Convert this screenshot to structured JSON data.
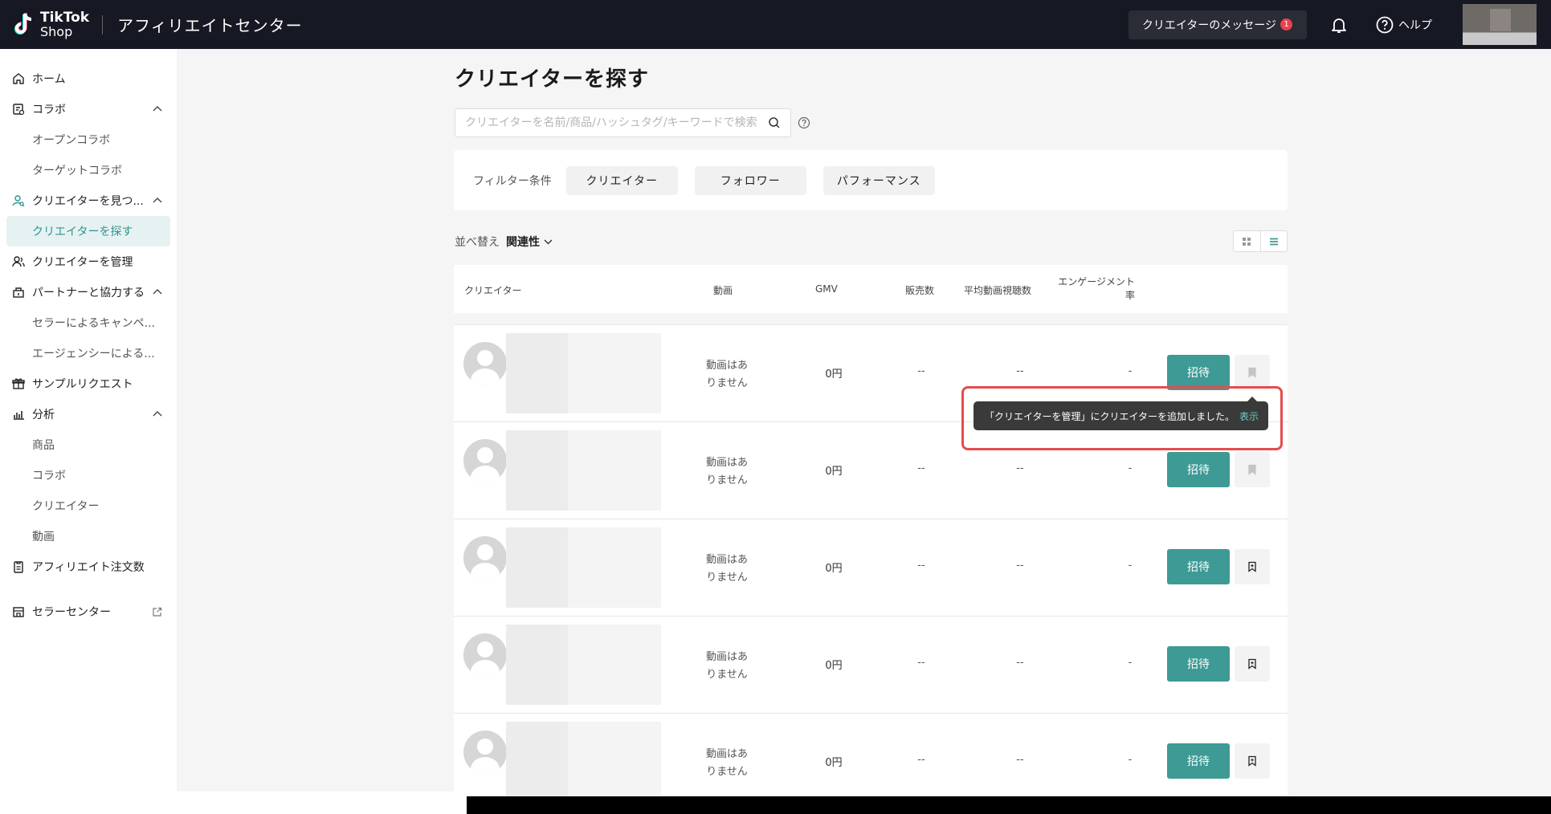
{
  "header": {
    "logo_line1": "TikTok",
    "logo_line2": "Shop",
    "title": "アフィリエイトセンター",
    "messages_label": "クリエイターのメッセージ",
    "messages_badge": "1",
    "help_label": "ヘルプ"
  },
  "sidebar": {
    "items": [
      {
        "label": "ホーム",
        "icon": "home-icon",
        "type": "top"
      },
      {
        "label": "コラボ",
        "icon": "collab-icon",
        "type": "top",
        "expanded": true
      },
      {
        "label": "オープンコラボ",
        "type": "sub"
      },
      {
        "label": "ターゲットコラボ",
        "type": "sub"
      },
      {
        "label": "クリエイターを見つ...",
        "icon": "find-creator-icon",
        "type": "top",
        "expanded": true
      },
      {
        "label": "クリエイターを探す",
        "type": "sub",
        "active": true
      },
      {
        "label": "クリエイターを管理",
        "icon": "manage-creator-icon",
        "type": "top"
      },
      {
        "label": "パートナーと協力する",
        "icon": "partner-icon",
        "type": "top",
        "expanded": true
      },
      {
        "label": "セラーによるキャンペ...",
        "type": "sub"
      },
      {
        "label": "エージェンシーによる...",
        "type": "sub"
      },
      {
        "label": "サンプルリクエスト",
        "icon": "gift-icon",
        "type": "top"
      },
      {
        "label": "分析",
        "icon": "analytics-icon",
        "type": "top",
        "expanded": true
      },
      {
        "label": "商品",
        "type": "sub"
      },
      {
        "label": "コラボ",
        "type": "sub"
      },
      {
        "label": "クリエイター",
        "type": "sub"
      },
      {
        "label": "動画",
        "type": "sub"
      },
      {
        "label": "アフィリエイト注文数",
        "icon": "orders-icon",
        "type": "top"
      },
      {
        "label": "セラーセンター",
        "icon": "store-icon",
        "type": "top",
        "external": true
      }
    ]
  },
  "main": {
    "title": "クリエイターを探す",
    "search_placeholder": "クリエイターを名前/商品/ハッシュタグ/キーワードで検索",
    "filter_label": "フィルター条件",
    "filters": [
      "クリエイター",
      "フォロワー",
      "パフォーマンス"
    ],
    "sort_label": "並べ替え",
    "sort_value": "関連性"
  },
  "table": {
    "headers": {
      "creator": "クリエイター",
      "video": "動画",
      "gmv": "GMV",
      "sales": "販売数",
      "avg_views": "平均動画視聴数",
      "engagement_1": "エンゲージメント",
      "engagement_2": "率"
    },
    "rows": [
      {
        "video_1": "動画はあ",
        "video_2": "りません",
        "gmv": "0円",
        "sales": "--",
        "avg_views": "--",
        "engagement": "-",
        "invite": "招待",
        "saved": true
      },
      {
        "video_1": "動画はあ",
        "video_2": "りません",
        "gmv": "0円",
        "sales": "--",
        "avg_views": "--",
        "engagement": "-",
        "invite": "招待",
        "saved": true
      },
      {
        "video_1": "動画はあ",
        "video_2": "りません",
        "gmv": "0円",
        "sales": "--",
        "avg_views": "--",
        "engagement": "-",
        "invite": "招待",
        "saved": false
      },
      {
        "video_1": "動画はあ",
        "video_2": "りません",
        "gmv": "0円",
        "sales": "--",
        "avg_views": "--",
        "engagement": "-",
        "invite": "招待",
        "saved": false
      },
      {
        "video_1": "動画はあ",
        "video_2": "りません",
        "gmv": "0円",
        "sales": "--",
        "avg_views": "--",
        "engagement": "-",
        "invite": "招待",
        "saved": false
      }
    ]
  },
  "toast": {
    "message": "「クリエイターを管理」にクリエイターを追加しました。",
    "link": "表示"
  },
  "colors": {
    "accent": "#3d9a95",
    "header_bg": "#161823",
    "highlight_border": "#e44d4d"
  }
}
